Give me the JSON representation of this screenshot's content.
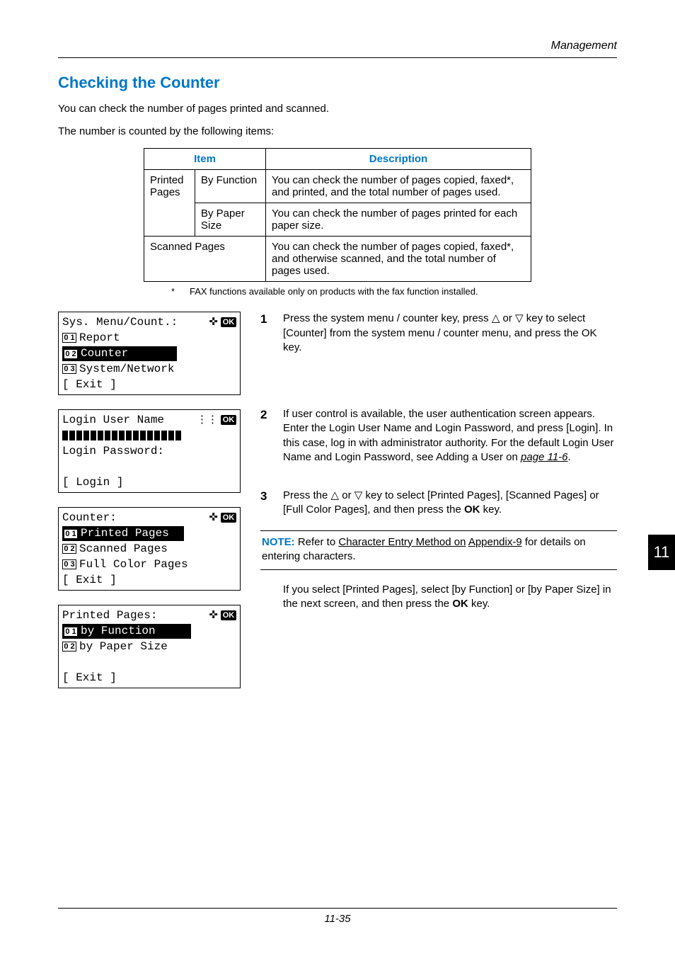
{
  "header": {
    "management": "Management"
  },
  "section_title": "Checking the Counter",
  "intro1": "You can check the number of pages printed and scanned.",
  "intro2": "The number is counted by the following items:",
  "table": {
    "h_item": "Item",
    "h_desc": "Description",
    "r1c1": "Printed Pages",
    "r1c2": "By Function",
    "r1c3": "You can check the number of pages copied, faxed*, and printed, and the total number of pages used.",
    "r2c2": "By Paper Size",
    "r2c3": "You can check the number of pages printed for each paper size.",
    "r3c1": "Scanned Pages",
    "r3c3": "You can check the number of pages copied, faxed*, and otherwise scanned, and the total number of pages used."
  },
  "footnote": {
    "ast": "*",
    "text": "FAX functions available only on products with the fax function installed."
  },
  "lcd1": {
    "title": "Sys. Menu/Count.:",
    "i1": "Report",
    "i2": "Counter",
    "i3": "System/Network",
    "exit": "[  Exit   ]",
    "n1": "0 1",
    "n2": "0 2",
    "n3": "0 3",
    "ok": "OK"
  },
  "lcd2": {
    "title": "Login User Name",
    "pwd": "Login Password:",
    "login": "[  Login  ]",
    "ok": "OK"
  },
  "lcd3": {
    "title": "Counter:",
    "i1": "Printed Pages",
    "i2": "Scanned Pages",
    "i3": "Full Color Pages",
    "exit": "[  Exit   ]",
    "n1": "0 1",
    "n2": "0 2",
    "n3": "0 3",
    "ok": "OK"
  },
  "lcd4": {
    "title": "Printed Pages:",
    "i1": "by Function",
    "i2": "by Paper Size",
    "exit": "[  Exit   ]",
    "n1": "0 1",
    "n2": "0 2",
    "ok": "OK"
  },
  "steps": {
    "s1n": "1",
    "s1a": "Press the system menu / counter key, press ",
    "s1b": " or ",
    "s1c": " key to select [Counter] from the system menu / counter menu, and press the OK key.",
    "s2n": "2",
    "s2a": "If user control is available, the user authentication screen appears. Enter the Login User Name and Login Password, and press [Login]. In this case, log in with administrator authority. For the default Login User Name and Login Password, see Adding a User on ",
    "s2link": "page 11-6",
    "s2end": ".",
    "s3n": "3",
    "s3a": "Press the ",
    "s3b": " or ",
    "s3c": " key to select [Printed Pages], [Scanned Pages] or [Full Color Pages], and then press the ",
    "s3ok": "OK",
    "s3d": " key."
  },
  "note": {
    "label": "NOTE:",
    "a": " Refer to ",
    "link1": "Character Entry Method on",
    "link2": "Appendix-9",
    "b": " for details on entering characters."
  },
  "after": {
    "a": "If you select [Printed Pages], select [by Function] or [by Paper Size] in the next screen, and then press the ",
    "ok": "OK",
    "b": " key."
  },
  "sidetab": "11",
  "pageno": "11-35",
  "glyph": {
    "up": "△",
    "down": "▽",
    "diamond": "✜",
    "dots": "⋮⋮"
  }
}
